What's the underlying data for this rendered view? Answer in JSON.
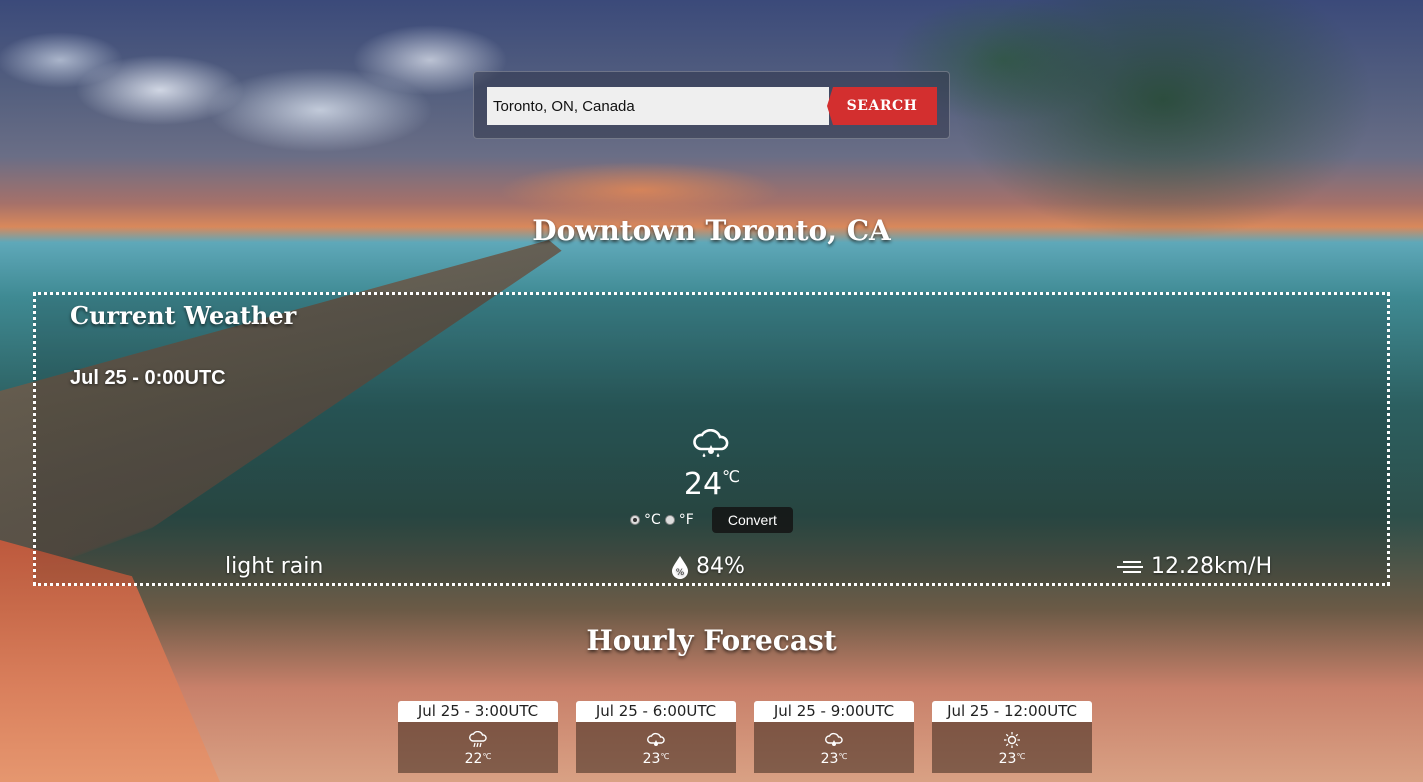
{
  "search": {
    "value": "Toronto, ON, Canada",
    "button_label": "SEARCH"
  },
  "location": {
    "title": "Downtown Toronto, CA"
  },
  "current": {
    "heading": "Current Weather",
    "datetime": "Jul 25 - 0:00UTC",
    "icon": "cloud-rain-icon",
    "temperature": "24",
    "temp_unit": "℃",
    "units": {
      "celsius_label": "°C",
      "fahrenheit_label": "°F",
      "selected": "celsius"
    },
    "convert_label": "Convert",
    "description": "light rain",
    "humidity": "84%",
    "wind": "12.28km/H"
  },
  "hourly": {
    "heading": "Hourly Forecast",
    "items": [
      {
        "time": "Jul 25 - 3:00UTC",
        "icon": "rain-cloud-icon",
        "temp": "22",
        "unit": "℃"
      },
      {
        "time": "Jul 25 - 6:00UTC",
        "icon": "cloud-rain-icon",
        "temp": "23",
        "unit": "℃"
      },
      {
        "time": "Jul 25 - 9:00UTC",
        "icon": "cloud-rain-icon",
        "temp": "23",
        "unit": "℃"
      },
      {
        "time": "Jul 25 - 12:00UTC",
        "icon": "sun-icon",
        "temp": "23",
        "unit": "℃"
      }
    ]
  },
  "colors": {
    "search_button": "#d32f2f",
    "search_input_bg": "#efefef"
  }
}
